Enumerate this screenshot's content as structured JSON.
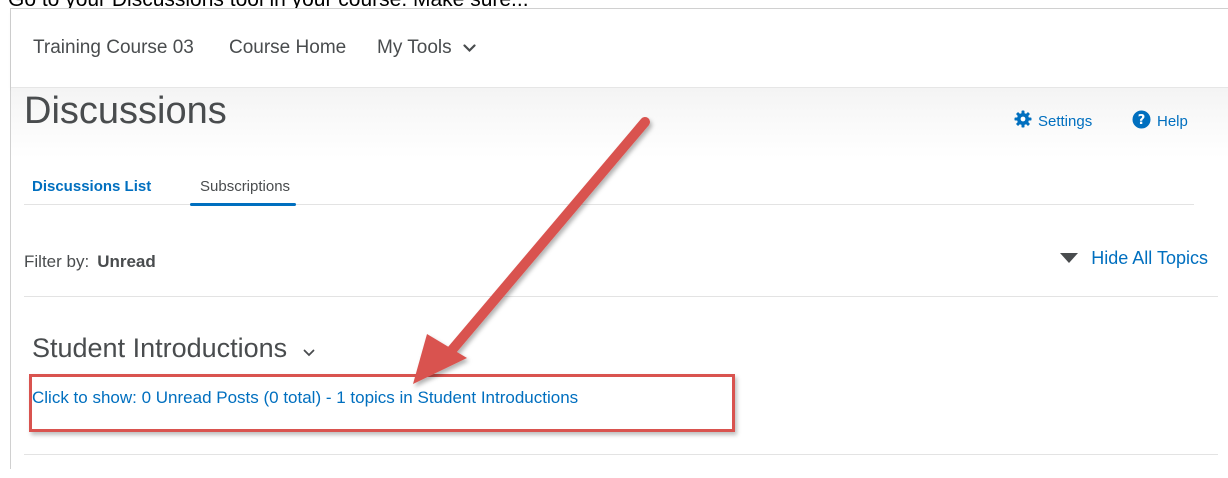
{
  "cropped_top_text": "Go to your Discussions tool in your course. Make sure...",
  "navbar": {
    "course_name": "Training Course 03",
    "course_home": "Course Home",
    "my_tools": "My Tools"
  },
  "header": {
    "title": "Discussions",
    "settings_label": "Settings",
    "help_label": "Help"
  },
  "tabs": [
    {
      "label": "Discussions List",
      "active": true
    },
    {
      "label": "Subscriptions",
      "active": false
    }
  ],
  "filter": {
    "label": "Filter by:",
    "value": "Unread"
  },
  "hide_all_topics": "Hide All Topics",
  "forum": {
    "title": "Student Introductions",
    "show_link": "Click to show: 0 Unread Posts (0 total) - 1 topics in Student Introductions"
  },
  "colors": {
    "link": "#006fbf",
    "text": "#494c4e",
    "annotation": "#d9534f"
  }
}
